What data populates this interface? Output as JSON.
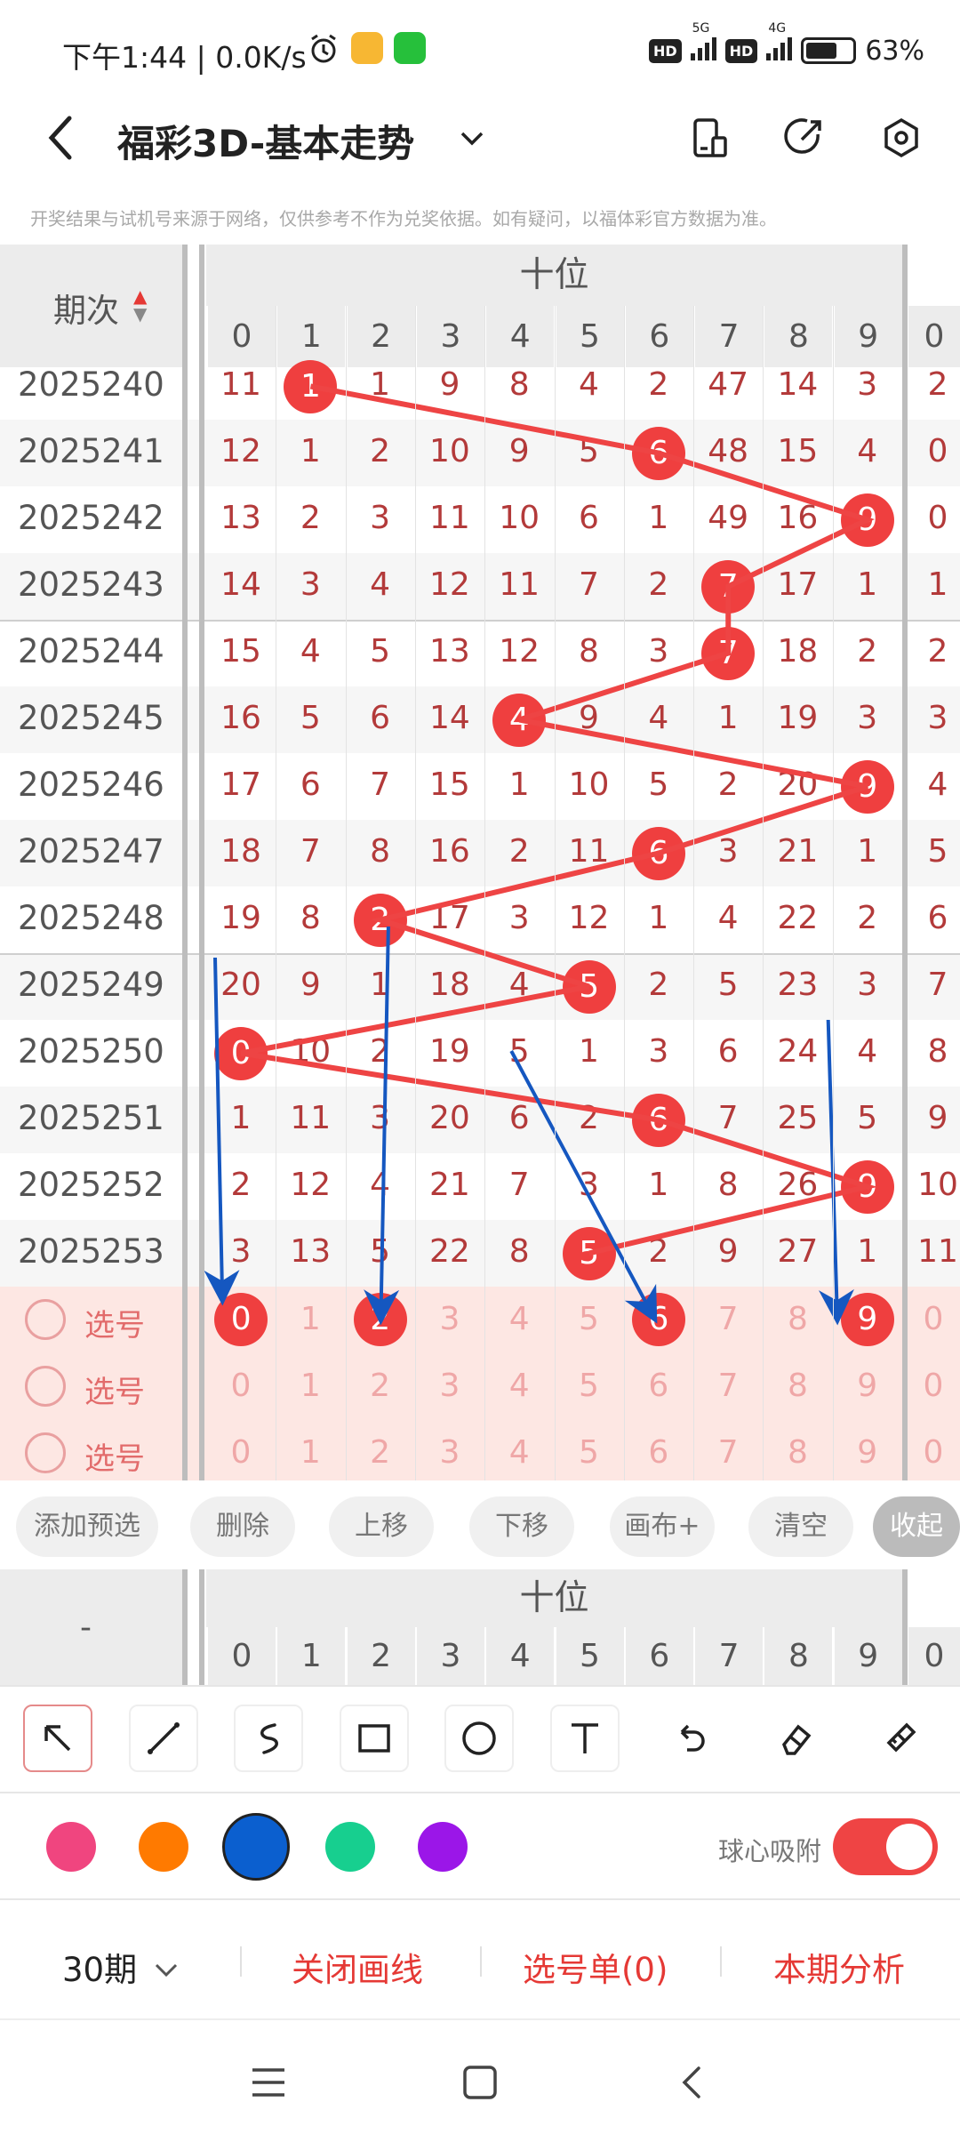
{
  "status_bar": {
    "time_speed": "下午1:44 | 0.0K/s",
    "hd1": "HD",
    "net1": "5G",
    "hd2": "HD",
    "net2": "4G",
    "battery": "63%",
    "battery_level": 0.63
  },
  "app_bar": {
    "back_icon": "chevron-left-icon",
    "title": "福彩3D-基本走势",
    "dropdown_icon": "chevron-down-icon",
    "actions": [
      "layout-icon",
      "share-icon",
      "settings-hex-icon"
    ]
  },
  "notice": "开奖结果与试机号来源于网络，仅供参考不作为兑奖依据。如有疑问，以福体彩官方数据为准。",
  "trend_table": {
    "period_header": "期次",
    "group_header": "十位",
    "digits": [
      "0",
      "1",
      "2",
      "3",
      "4",
      "5",
      "6",
      "7",
      "8",
      "9"
    ],
    "next_group_first_digit": "0",
    "rows": [
      {
        "period": "2025240",
        "hit": 1,
        "cells": [
          "11",
          "1",
          "1",
          "9",
          "8",
          "4",
          "2",
          "47",
          "14",
          "3"
        ],
        "next": "2"
      },
      {
        "period": "2025241",
        "hit": 6,
        "cells": [
          "12",
          "1",
          "2",
          "10",
          "9",
          "5",
          "6",
          "48",
          "15",
          "4"
        ],
        "next": "0"
      },
      {
        "period": "2025242",
        "hit": 9,
        "cells": [
          "13",
          "2",
          "3",
          "11",
          "10",
          "6",
          "1",
          "49",
          "16",
          "9"
        ],
        "next": "0"
      },
      {
        "period": "2025243",
        "hit": 7,
        "cells": [
          "14",
          "3",
          "4",
          "12",
          "11",
          "7",
          "2",
          "7",
          "17",
          "1"
        ],
        "next": "1"
      },
      {
        "period": "2025244",
        "hit": 7,
        "cells": [
          "15",
          "4",
          "5",
          "13",
          "12",
          "8",
          "3",
          "7",
          "18",
          "2"
        ],
        "next": "2"
      },
      {
        "period": "2025245",
        "hit": 4,
        "cells": [
          "16",
          "5",
          "6",
          "14",
          "4",
          "9",
          "4",
          "1",
          "19",
          "3"
        ],
        "next": "3"
      },
      {
        "period": "2025246",
        "hit": 9,
        "cells": [
          "17",
          "6",
          "7",
          "15",
          "1",
          "10",
          "5",
          "2",
          "20",
          "9"
        ],
        "next": "4"
      },
      {
        "period": "2025247",
        "hit": 6,
        "cells": [
          "18",
          "7",
          "8",
          "16",
          "2",
          "11",
          "6",
          "3",
          "21",
          "1"
        ],
        "next": "5"
      },
      {
        "period": "2025248",
        "hit": 2,
        "cells": [
          "19",
          "8",
          "2",
          "17",
          "3",
          "12",
          "1",
          "4",
          "22",
          "2"
        ],
        "next": "6"
      },
      {
        "period": "2025249",
        "hit": 5,
        "cells": [
          "20",
          "9",
          "1",
          "18",
          "4",
          "5",
          "2",
          "5",
          "23",
          "3"
        ],
        "next": "7"
      },
      {
        "period": "2025250",
        "hit": 0,
        "cells": [
          "0",
          "10",
          "2",
          "19",
          "5",
          "1",
          "3",
          "6",
          "24",
          "4"
        ],
        "next": "8"
      },
      {
        "period": "2025251",
        "hit": 6,
        "cells": [
          "1",
          "11",
          "3",
          "20",
          "6",
          "2",
          "6",
          "7",
          "25",
          "5"
        ],
        "next": "9"
      },
      {
        "period": "2025252",
        "hit": 9,
        "cells": [
          "2",
          "12",
          "4",
          "21",
          "7",
          "3",
          "1",
          "8",
          "26",
          "9"
        ],
        "next": "10"
      },
      {
        "period": "2025253",
        "hit": 5,
        "cells": [
          "3",
          "13",
          "5",
          "22",
          "8",
          "5",
          "2",
          "9",
          "27",
          "1"
        ],
        "next": "11"
      }
    ],
    "select_rows": [
      {
        "label": "选号",
        "picked": [
          0,
          2,
          6,
          9
        ]
      },
      {
        "label": "选号",
        "picked": []
      },
      {
        "label": "选号",
        "picked": []
      }
    ],
    "select_next_digit": "0"
  },
  "action_buttons": [
    "添加预选",
    "删除",
    "上移",
    "下移",
    "画布+",
    "清空",
    "收起"
  ],
  "mini_header": {
    "left_label": "-",
    "group_header": "十位",
    "digits": [
      "0",
      "1",
      "2",
      "3",
      "4",
      "5",
      "6",
      "7",
      "8",
      "9"
    ],
    "next_group_first_digit": "0"
  },
  "draw_tools": [
    "arrow-pointer-icon",
    "line-icon",
    "freehand-icon",
    "rectangle-icon",
    "circle-icon",
    "text-icon",
    "undo-icon",
    "eraser-icon",
    "clear-brush-icon"
  ],
  "colors": [
    "#f0457f",
    "#ff7a00",
    "#0b5fcf",
    "#17cf8f",
    "#9b16e8"
  ],
  "selected_color": "#0b5fcf",
  "snap_label": "球心吸附",
  "snap_enabled": true,
  "bottom_bar": {
    "periods": "30期",
    "close_lines": "关闭画线",
    "selection_list": "选号单(0)",
    "analysis": "本期分析"
  },
  "nav_bar": [
    "menu-icon",
    "home-square-icon",
    "back-icon"
  ]
}
